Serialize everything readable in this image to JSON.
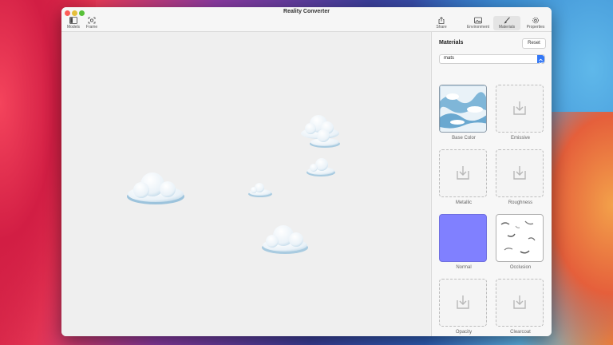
{
  "window": {
    "title": "Reality Converter"
  },
  "toolbar": {
    "models_label": "Models",
    "frame_label": "Frame",
    "share_label": "Share",
    "environment_label": "Environment",
    "materials_label": "Materials",
    "properties_label": "Properties"
  },
  "panel": {
    "title": "Materials",
    "reset_label": "Reset",
    "material_select_value": "mats",
    "slots": [
      {
        "label": "Base Color",
        "state": "texture"
      },
      {
        "label": "Emissive",
        "state": "empty"
      },
      {
        "label": "Metallic",
        "state": "empty"
      },
      {
        "label": "Roughness",
        "state": "empty"
      },
      {
        "label": "Normal",
        "state": "texture"
      },
      {
        "label": "Occlusion",
        "state": "texture"
      },
      {
        "label": "Opacity",
        "state": "empty"
      },
      {
        "label": "Clearcoat",
        "state": "empty"
      }
    ]
  },
  "icons": {
    "models": "sidebar-icon",
    "frame": "frame-icon",
    "share": "share-icon",
    "environment": "image-icon",
    "materials": "paintbrush-icon",
    "properties": "gear-icon",
    "drop_slot": "download-tray-icon"
  },
  "colors": {
    "normal_map": "#8080ff",
    "accent": "#3478f6"
  }
}
